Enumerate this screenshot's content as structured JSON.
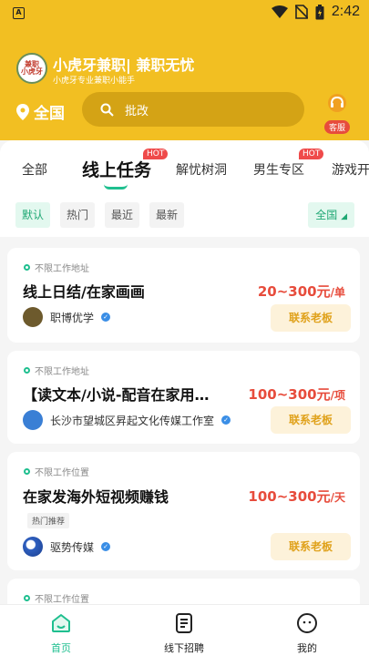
{
  "status_bar": {
    "time": "2:42"
  },
  "header": {
    "logo_text": "兼职小虎牙",
    "title": "小虎牙兼职| 兼职无忧",
    "subtitle": "小虎牙专业兼职小能手",
    "city": "全国",
    "search_placeholder": "批改",
    "service_label": "客服"
  },
  "tabs": [
    {
      "label": "全部"
    },
    {
      "label": "线上任务",
      "badge": "HOT",
      "active": true
    },
    {
      "label": "解忧树洞"
    },
    {
      "label": "男生专区",
      "badge": "HOT"
    },
    {
      "label": "游戏开"
    }
  ],
  "filters": {
    "chips": [
      "默认",
      "热门",
      "最近",
      "最新"
    ],
    "region": "全国"
  },
  "jobs": [
    {
      "location": "不限工作地址",
      "title": "线上日结/在家画画",
      "salary": "20~300元",
      "salary_unit": "/单",
      "company": "职博优学",
      "contact_label": "联系老板"
    },
    {
      "location": "不限工作地址",
      "title": "【读文本/小说-配音在家用…",
      "salary": "100~300元",
      "salary_unit": "/项",
      "company": "长沙市望城区昇起文化传媒工作室",
      "contact_label": "联系老板"
    },
    {
      "location": "不限工作位置",
      "title": "在家发海外短视频赚钱",
      "tag": "热门推荐",
      "salary": "100~300元",
      "salary_unit": "/天",
      "company": "驱势传媒",
      "contact_label": "联系老板"
    },
    {
      "location": "不限工作位置"
    }
  ],
  "bottom_nav": [
    {
      "label": "首页",
      "icon": "home-icon",
      "active": true
    },
    {
      "label": "线下招聘",
      "icon": "document-icon"
    },
    {
      "label": "我的",
      "icon": "face-icon"
    }
  ],
  "colors": {
    "brand_yellow": "#f2bf22",
    "accent_green": "#1fbf8f",
    "salary_red": "#e74c3c"
  }
}
